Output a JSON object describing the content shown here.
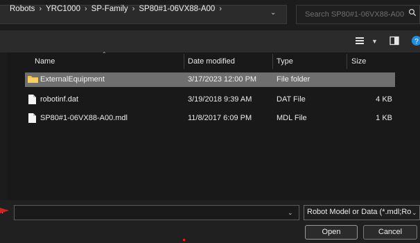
{
  "address_bar": {
    "breadcrumbs": [
      "Robots",
      "YRC1000",
      "SP-Family",
      "SP80#1-06VX88-A00"
    ],
    "separator": "›"
  },
  "search": {
    "placeholder": "Search SP80#1-06VX88-A00"
  },
  "columns": {
    "name": "Name",
    "date": "Date modified",
    "type": "Type",
    "size": "Size"
  },
  "files": [
    {
      "name": "ExternalEquipment",
      "date": "3/17/2023 12:00 PM",
      "type": "File folder",
      "size": "",
      "icon": "folder-icon",
      "selected": true
    },
    {
      "name": "robotinf.dat",
      "date": "3/19/2018 9:39 AM",
      "type": "DAT File",
      "size": "4 KB",
      "icon": "file-icon",
      "selected": false
    },
    {
      "name": "SP80#1-06VX88-A00.mdl",
      "date": "11/8/2017 6:09 PM",
      "type": "MDL File",
      "size": "1 KB",
      "icon": "file-icon",
      "selected": false
    }
  ],
  "bottom": {
    "filename_label": ":",
    "filename_value": "",
    "file_type_filter": "Robot Model or Data (*.mdl;Ro",
    "open_label": "Open",
    "cancel_label": "Cancel"
  },
  "colors": {
    "folder": "#f2c14e",
    "selected_row": "#6f6f6f",
    "help_icon": "#1f8fe6",
    "arrow": "#d22222"
  }
}
